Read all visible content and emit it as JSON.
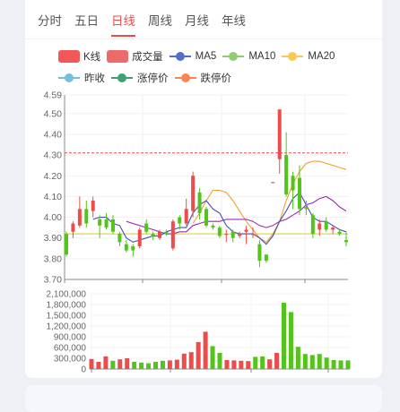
{
  "tabs": [
    {
      "label": "分时",
      "active": false
    },
    {
      "label": "五日",
      "active": false
    },
    {
      "label": "日线",
      "active": true
    },
    {
      "label": "周线",
      "active": false
    },
    {
      "label": "月线",
      "active": false
    },
    {
      "label": "年线",
      "active": false
    }
  ],
  "legend": {
    "kline": {
      "label": "K线",
      "color": "#f25858"
    },
    "volume": {
      "label": "成交量",
      "color": "#ec6a6a"
    },
    "ma5": {
      "label": "MA5",
      "color": "#5470c6"
    },
    "ma10": {
      "label": "MA10",
      "color": "#91cc75"
    },
    "ma20": {
      "label": "MA20",
      "color": "#fac858"
    },
    "prev_close": {
      "label": "昨收",
      "color": "#73c0de"
    },
    "limit_up": {
      "label": "涨停价",
      "color": "#3ba272"
    },
    "limit_down": {
      "label": "跌停价",
      "color": "#fc8452"
    }
  },
  "colors": {
    "up": "#ee4b4b",
    "down": "#52c41a",
    "ma5_line": "#3f51b5",
    "ma10_line": "#9c27b0",
    "ma20_line": "#f0a030",
    "prev_close_line": "#d4d40a",
    "limit_line": "#e84b4b"
  },
  "chart_data": [
    {
      "type": "candlestick",
      "ylim": [
        3.7,
        4.59
      ],
      "yticks": [
        "4.59",
        "4.50",
        "4.40",
        "4.30",
        "4.20",
        "4.10",
        "4.00",
        "3.90",
        "3.80",
        "3.70"
      ],
      "ytick_values": [
        4.59,
        4.5,
        4.4,
        4.3,
        4.2,
        4.1,
        4.0,
        3.9,
        3.8,
        3.7
      ],
      "prev_close": 3.92,
      "limit_up": 4.31,
      "candles": [
        [
          3.92,
          3.82,
          3.93,
          3.81
        ],
        [
          3.93,
          3.97,
          3.98,
          3.9
        ],
        [
          3.96,
          4.04,
          4.1,
          3.95
        ],
        [
          4.04,
          3.97,
          4.08,
          3.95
        ],
        [
          4.03,
          4.08,
          4.1,
          4.0
        ],
        [
          3.99,
          3.96,
          4.01,
          3.9
        ],
        [
          3.99,
          3.95,
          4.02,
          3.94
        ],
        [
          3.99,
          3.93,
          4.01,
          3.92
        ],
        [
          3.92,
          3.88,
          3.93,
          3.86
        ],
        [
          3.87,
          3.84,
          3.89,
          3.83
        ],
        [
          3.86,
          3.84,
          3.87,
          3.81
        ],
        [
          3.86,
          3.94,
          3.95,
          3.85
        ],
        [
          3.97,
          3.93,
          3.99,
          3.92
        ],
        [
          3.92,
          3.91,
          3.93,
          3.89
        ],
        [
          3.9,
          3.93,
          3.94,
          3.89
        ],
        [
          3.93,
          3.92,
          3.94,
          3.91
        ],
        [
          3.85,
          3.98,
          3.99,
          3.84
        ],
        [
          4.0,
          3.97,
          4.01,
          3.94
        ],
        [
          3.97,
          4.04,
          4.09,
          3.96
        ],
        [
          4.03,
          4.2,
          4.22,
          4.0
        ],
        [
          4.12,
          4.02,
          4.14,
          3.99
        ],
        [
          4.04,
          3.96,
          4.05,
          3.95
        ],
        [
          3.96,
          3.95,
          3.97,
          3.94
        ],
        [
          3.95,
          3.91,
          3.96,
          3.9
        ],
        [
          3.92,
          3.92,
          3.94,
          3.88
        ],
        [
          3.93,
          3.9,
          3.94,
          3.88
        ],
        [
          3.91,
          3.92,
          3.93,
          3.9
        ],
        [
          3.93,
          3.94,
          3.96,
          3.87
        ],
        [
          3.92,
          3.92,
          3.95,
          3.9
        ],
        [
          3.87,
          3.79,
          3.89,
          3.76
        ],
        [
          3.82,
          3.79,
          3.82,
          3.78
        ],
        [
          4.17,
          4.17,
          4.17,
          4.17
        ],
        [
          4.28,
          4.52,
          4.52,
          4.21
        ],
        [
          4.3,
          4.11,
          4.41,
          4.1
        ],
        [
          4.2,
          4.13,
          4.22,
          4.04
        ],
        [
          4.19,
          4.04,
          4.25,
          4.01
        ],
        [
          4.05,
          4.04,
          4.08,
          4.01
        ],
        [
          4.01,
          3.92,
          4.02,
          3.9
        ],
        [
          3.94,
          3.97,
          3.99,
          3.91
        ],
        [
          3.98,
          3.94,
          4.0,
          3.93
        ],
        [
          3.94,
          3.95,
          3.96,
          3.92
        ],
        [
          3.93,
          3.92,
          3.94,
          3.91
        ],
        [
          3.89,
          3.88,
          3.93,
          3.86
        ]
      ],
      "ma5": [
        null,
        null,
        null,
        null,
        3.99,
        4.0,
        4.0,
        3.97,
        3.96,
        3.9,
        3.88,
        3.89,
        3.9,
        3.91,
        3.91,
        3.93,
        3.94,
        3.95,
        3.95,
        4.02,
        4.06,
        4.08,
        4.04,
        4.02,
        3.96,
        3.93,
        3.92,
        3.92,
        3.92,
        3.9,
        3.87,
        3.91,
        3.98,
        4.03,
        4.09,
        4.12,
        4.06,
        4.0,
        3.98,
        3.98,
        3.96,
        3.94,
        3.93
      ],
      "ma10": [
        null,
        null,
        null,
        null,
        null,
        null,
        null,
        null,
        null,
        3.98,
        3.97,
        3.96,
        3.95,
        3.94,
        3.93,
        3.92,
        3.92,
        3.93,
        3.93,
        3.96,
        3.97,
        3.98,
        3.98,
        3.98,
        3.99,
        3.99,
        3.99,
        3.99,
        3.98,
        3.96,
        3.95,
        3.96,
        3.98,
        3.99,
        4.01,
        4.03,
        4.06,
        4.07,
        4.09,
        4.1,
        4.08,
        4.05,
        4.03
      ],
      "ma20": [
        null,
        null,
        null,
        null,
        null,
        null,
        null,
        null,
        null,
        null,
        null,
        null,
        null,
        null,
        null,
        null,
        null,
        null,
        null,
        3.97,
        4.02,
        4.08,
        4.13,
        4.13,
        4.12,
        4.08,
        4.03,
        3.98,
        3.94,
        3.9,
        3.88,
        3.92,
        3.98,
        4.08,
        4.16,
        4.22,
        4.26,
        4.27,
        4.27,
        4.26,
        4.25,
        4.24,
        4.23
      ]
    },
    {
      "type": "bar",
      "series_name": "成交量",
      "ylim": [
        0,
        2100000
      ],
      "yticks": [
        "2,100,000",
        "1,800,000",
        "1,500,000",
        "1,200,000",
        "900,000",
        "600,000",
        "300,000",
        "0"
      ],
      "ytick_values": [
        2100000,
        1800000,
        1500000,
        1200000,
        900000,
        600000,
        300000,
        0
      ],
      "values": [
        280000,
        200000,
        350000,
        230000,
        270000,
        300000,
        200000,
        180000,
        160000,
        200000,
        230000,
        240000,
        260000,
        430000,
        470000,
        750000,
        1040000,
        640000,
        450000,
        250000,
        240000,
        230000,
        220000,
        340000,
        350000,
        270000,
        450000,
        1850000,
        1590000,
        620000,
        420000,
        390000,
        420000,
        320000,
        250000,
        240000,
        240000
      ],
      "up": [
        true,
        true,
        true,
        false,
        true,
        true,
        false,
        false,
        false,
        false,
        false,
        true,
        true,
        true,
        true,
        true,
        true,
        false,
        false,
        true,
        true,
        true,
        true,
        false,
        false,
        true,
        true,
        false,
        false,
        false,
        false,
        false,
        false,
        false,
        false,
        false,
        false
      ]
    }
  ]
}
